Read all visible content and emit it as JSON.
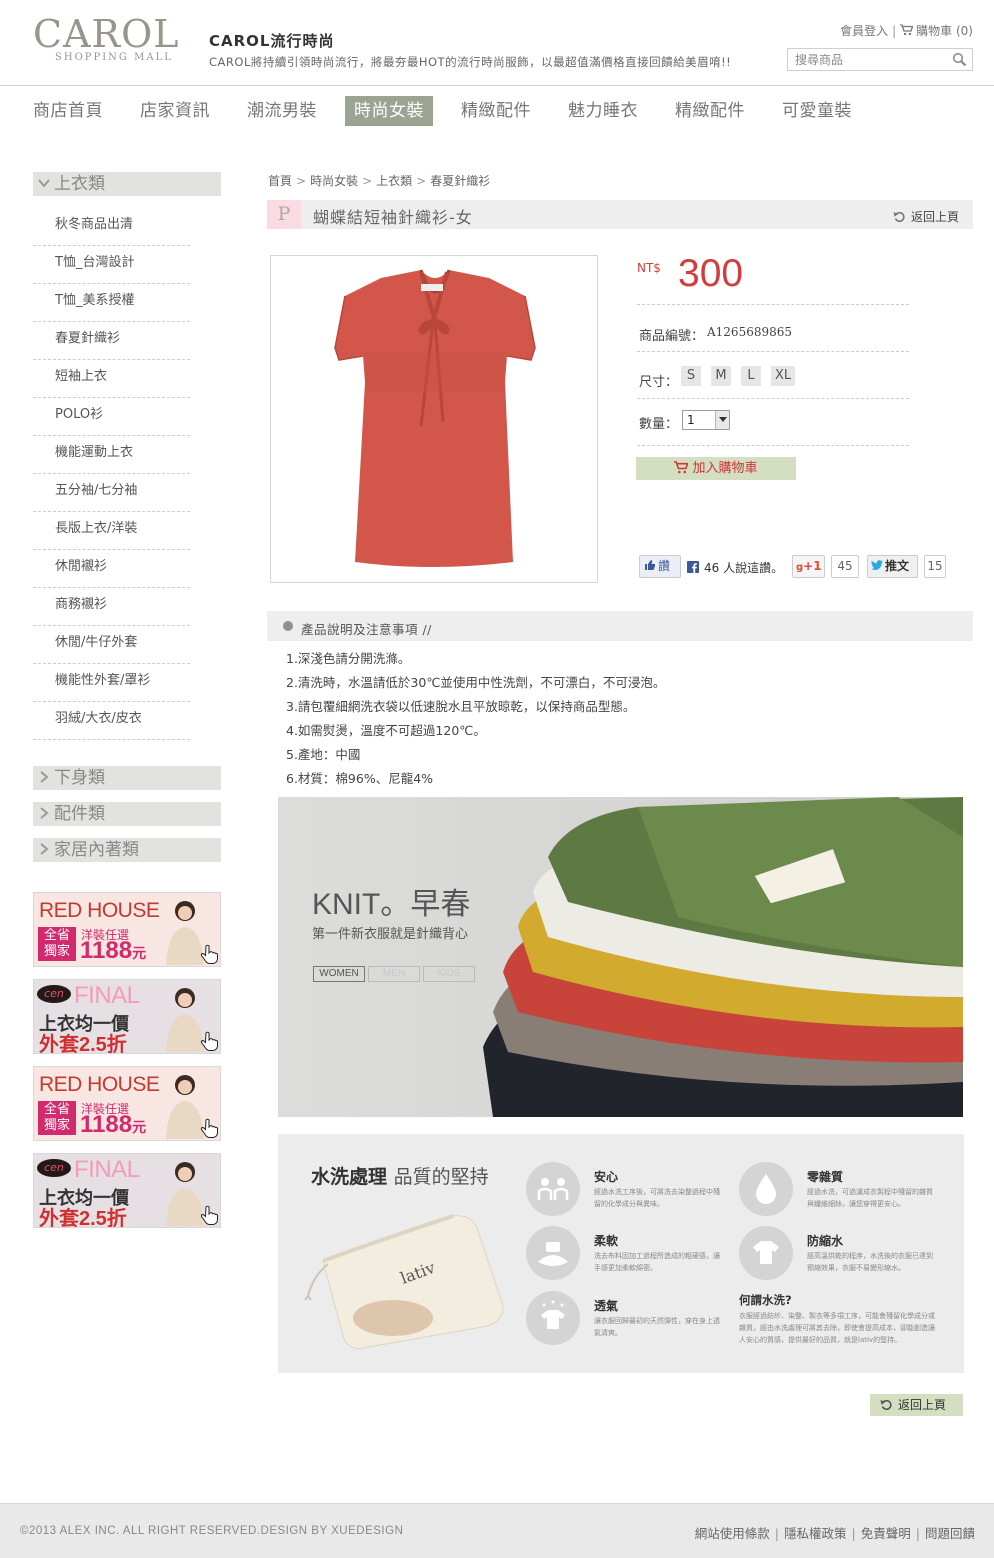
{
  "header": {
    "logo_word": "CAROL",
    "logo_sub": "SHOPPING MALL",
    "site_title": "CAROL流行時尚",
    "site_desc": "CAROL將持續引領時尚流行，將最夯最HOT的流行時尚服飾，以最超值滿價格直接回饋給美眉唷!!",
    "member_login": "會員登入",
    "cart_label": "購物車 (0)",
    "search_placeholder": "搜尋商品"
  },
  "mainnav": [
    {
      "label": "商店首頁",
      "active": false
    },
    {
      "label": "店家資訊",
      "active": false
    },
    {
      "label": "潮流男裝",
      "active": false
    },
    {
      "label": "時尚女裝",
      "active": true
    },
    {
      "label": "精緻配件",
      "active": false
    },
    {
      "label": "魅力睡衣",
      "active": false
    },
    {
      "label": "精緻配件",
      "active": false
    },
    {
      "label": "可愛童裝",
      "active": false
    }
  ],
  "sidebar": {
    "expanded_category": "上衣類",
    "items": [
      "秋冬商品出清",
      "T恤_台灣設計",
      "T恤_美系授權",
      "春夏針織衫",
      "短袖上衣",
      "POLO衫",
      "機能運動上衣",
      "五分袖/七分袖",
      "長版上衣/洋裝",
      "休閒襯衫",
      "商務襯衫",
      "休閒/牛仔外套",
      "機能性外套/罩衫",
      "羽絨/大衣/皮衣"
    ],
    "collapsed_categories": [
      "下身類",
      "配件類",
      "家居內著類"
    ],
    "banners": [
      {
        "type": "redhouse",
        "title": "RED HOUSE",
        "badge": "全省獨家",
        "line1": "洋裝任選",
        "line2": "1188",
        "unit": "元"
      },
      {
        "type": "final",
        "logo": "cen",
        "title": "FINAL",
        "line1": "上衣均一價",
        "line2": "外套2.5折"
      },
      {
        "type": "redhouse",
        "title": "RED HOUSE",
        "badge": "全省獨家",
        "line1": "洋裝任選",
        "line2": "1188",
        "unit": "元"
      },
      {
        "type": "final",
        "logo": "cen",
        "title": "FINAL",
        "line1": "上衣均一價",
        "line2": "外套2.5折"
      }
    ]
  },
  "breadcrumb": [
    "首頁",
    "時尚女裝",
    "上衣類",
    "春夏針織衫"
  ],
  "product": {
    "p_mark": "P",
    "title": "蝴蝶結短袖針織衫-女",
    "back_label": "返回上頁",
    "currency": "NT$",
    "price": "300",
    "sku_label": "商品編號：",
    "sku": "A1265689865",
    "size_label": "尺寸：",
    "sizes": [
      "S",
      "M",
      "L",
      "XL"
    ],
    "qty_label": "數量：",
    "qty_value": "1",
    "add_cart": "加入購物車",
    "dress_color": "#d2574a"
  },
  "social": {
    "like_label": "讚",
    "fb_count": "46 人說這讚。",
    "gplus_label": "+1",
    "gplus_count": "45",
    "tweet_label": "推文",
    "tweet_count": "15"
  },
  "description": {
    "heading": "產品說明及注意事項 //",
    "items": [
      "1.深淺色請分開洗滌。",
      "2.清洗時，水溫請低於30℃並使用中性洗劑，不可漂白，不可浸泡。",
      "3.請包覆細網洗衣袋以低速脫水且平放晾乾，以保持商品型態。",
      "4.如需熨燙，溫度不可超過120℃。",
      "5.產地：中國",
      "6.材質：棉96%、尼龍4%"
    ]
  },
  "knit_banner": {
    "title": "KNIT。早春",
    "subtitle": "第一件新衣服就是針織背心",
    "tabs": [
      "WOMEN",
      "MEN",
      "KIDS"
    ],
    "tag_text": "lativ"
  },
  "wash_banner": {
    "title_bold": "水洗處理",
    "title_rest": "品質的堅持",
    "bag_text": "lativ",
    "features": [
      {
        "title": "安心",
        "desc": "經過水洗工序後，可將洗去染整過程中殘留的化學成分與異味。"
      },
      {
        "title": "柔軟",
        "desc": "洗去布料因加工過程所造成的粗硬感，讓手感更加柔軟綿密。"
      },
      {
        "title": "透氣",
        "desc": "讓衣服回歸最初的天然彈性，穿在身上透氣清爽。"
      },
      {
        "title": "零雜質",
        "desc": "經過水洗，可過濾成衣製程中殘留的雜質與纖維細絲，讓您穿得更安心。"
      },
      {
        "title": "防縮水",
        "desc": "經高溫烘乾的程序，水洗後的衣服已達到預縮效果，衣服不易變形縮水。"
      },
      {
        "title": "何謂水洗?",
        "desc": "衣服經過紡紗、染整、製衣等多項工序，可能會殘留化學成分或雜質，經由水洗處理可將其去除，即使會提高成本，卻能創造讓人安心的質感，提供最好的品質，就是lativ的堅持。"
      }
    ]
  },
  "back_bottom": "返回上頁",
  "footer": {
    "copyright": "©2013 ALEX INC. ALL RIGHT RESERVED.DESIGN BY XUEDESIGN",
    "links": [
      "網站使用條款",
      "隱私權政策",
      "免責聲明",
      "問題回饋"
    ]
  },
  "colors": {
    "accent_green": "#9aa491",
    "price_red": "#d43c3c",
    "cart_button_bg": "#d3dfc0"
  }
}
